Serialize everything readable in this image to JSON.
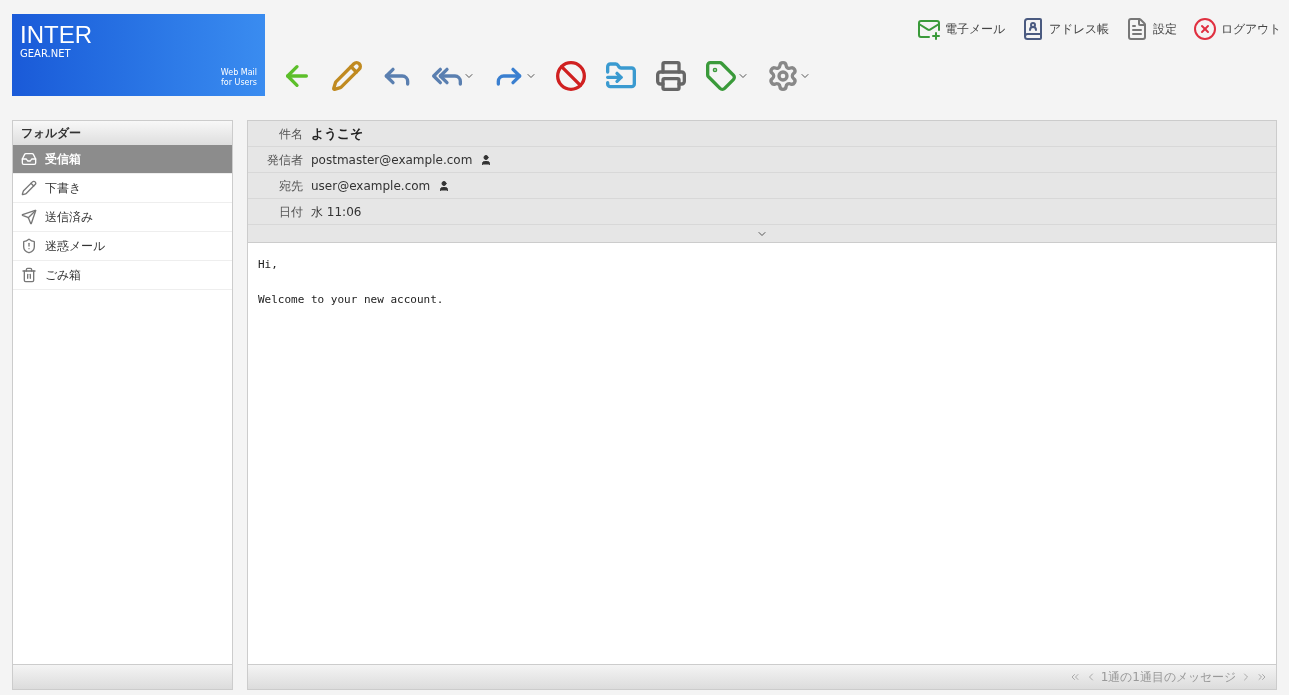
{
  "logo": {
    "title": "INTER",
    "subtitle": "GEAR.NET",
    "tagline_1": "Web Mail",
    "tagline_2": "for Users"
  },
  "top_links": [
    {
      "kind": "mail",
      "label": "電子メール"
    },
    {
      "kind": "addressbook",
      "label": "アドレス帳"
    },
    {
      "kind": "settings",
      "label": "設定"
    },
    {
      "kind": "logout",
      "label": "ログアウト"
    }
  ],
  "toolbar": [
    {
      "kind": "back",
      "dropdown": false
    },
    {
      "kind": "compose",
      "dropdown": false
    },
    {
      "kind": "reply",
      "dropdown": false
    },
    {
      "kind": "reply_all",
      "dropdown": true
    },
    {
      "kind": "forward",
      "dropdown": true
    },
    {
      "kind": "delete",
      "dropdown": false
    },
    {
      "kind": "move",
      "dropdown": false
    },
    {
      "kind": "print",
      "dropdown": false
    },
    {
      "kind": "mark",
      "dropdown": true
    },
    {
      "kind": "more",
      "dropdown": true
    }
  ],
  "sidebar": {
    "title": "フォルダー",
    "items": [
      {
        "kind": "inbox",
        "label": "受信箱",
        "selected": true
      },
      {
        "kind": "drafts",
        "label": "下書き",
        "selected": false
      },
      {
        "kind": "sent",
        "label": "送信済み",
        "selected": false
      },
      {
        "kind": "junk",
        "label": "迷惑メール",
        "selected": false
      },
      {
        "kind": "trash",
        "label": "ごみ箱",
        "selected": false
      }
    ]
  },
  "message": {
    "headers": [
      {
        "label": "件名",
        "value": "ようこそ",
        "bold": true,
        "contact": false
      },
      {
        "label": "発信者",
        "value": "postmaster@example.com",
        "bold": false,
        "contact": true
      },
      {
        "label": "宛先",
        "value": "user@example.com",
        "bold": false,
        "contact": true
      },
      {
        "label": "日付",
        "value": "水 11:06",
        "bold": false,
        "contact": false
      }
    ],
    "body": [
      "Hi,",
      "Welcome to your new account."
    ]
  },
  "status_bar": {
    "text": "1通の1通目のメッセージ"
  }
}
